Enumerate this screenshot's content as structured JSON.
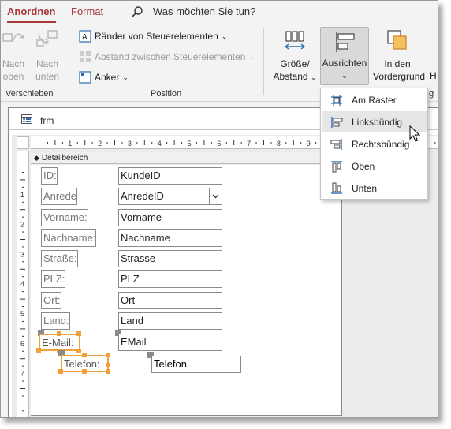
{
  "tabs": {
    "anordnen": "Anordnen",
    "format": "Format"
  },
  "search": {
    "text": "Was möchten Sie tun?"
  },
  "ribbon": {
    "verschieben": {
      "label": "Verschieben",
      "nach_oben": [
        "Nach",
        "oben"
      ],
      "nach_unten": [
        "Nach",
        "unten"
      ]
    },
    "position": {
      "label": "Position",
      "raender": "Ränder von Steuerelementen",
      "abstand": "Abstand zwischen Steuerelementen",
      "anker": "Anker"
    },
    "groesse": [
      "Größe/",
      "Abstand"
    ],
    "ausrichten": "Ausrichten",
    "vordergrund": [
      "In den",
      "Vordergrund"
    ],
    "cut_h": "H",
    "cut_g": "g"
  },
  "menu": [
    {
      "label": "Am Raster",
      "icon": "grid-align-icon"
    },
    {
      "label": "Linksbündig",
      "icon": "align-left-icon"
    },
    {
      "label": "Rechtsbündig",
      "icon": "align-right-icon"
    },
    {
      "label": "Oben",
      "icon": "align-top-icon"
    },
    {
      "label": "Unten",
      "icon": "align-bottom-icon"
    }
  ],
  "form": {
    "title": "frm",
    "ruler_numbers": [
      "1",
      "2",
      "3",
      "4",
      "5",
      "6",
      "7",
      "8",
      "9"
    ],
    "vruler_numbers": [
      "1",
      "2",
      "3",
      "4",
      "5",
      "6",
      "7"
    ],
    "section": "Detailbereich",
    "fields": [
      {
        "label": "ID:",
        "control": "KundeID"
      },
      {
        "label": "Anrede",
        "control": "AnredeID"
      },
      {
        "label": "Vorname:",
        "control": "Vorname"
      },
      {
        "label": "Nachname:",
        "control": "Nachname"
      },
      {
        "label": "Straße:",
        "control": "Strasse"
      },
      {
        "label": "PLZ:",
        "control": "PLZ"
      },
      {
        "label": "Ort:",
        "control": "Ort"
      },
      {
        "label": "Land:",
        "control": "Land"
      },
      {
        "label": "E-Mail:",
        "control": "EMail"
      },
      {
        "label": "Telefon:",
        "control": "Telefon"
      }
    ]
  },
  "colors": {
    "accent": "#a4373a",
    "selection": "#f2a13a"
  }
}
